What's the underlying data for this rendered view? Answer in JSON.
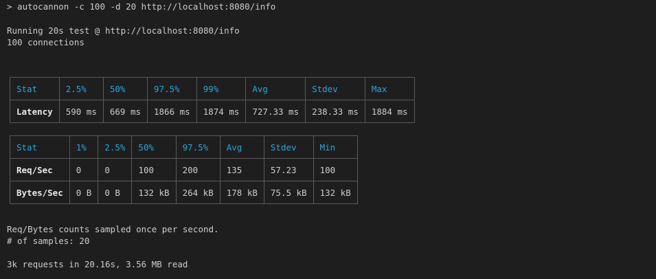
{
  "terminal": {
    "command_line": "> autocannon -c 100 -d 20 http://localhost:8080/info",
    "running_line": "Running 20s test @ http://localhost:8080/info",
    "connections_line": "100 connections",
    "footer_sampled": "Req/Bytes counts sampled once per second.",
    "footer_samples": "# of samples: 20",
    "footer_summary": "3k requests in 20.16s, 3.56 MB read"
  },
  "latency_table": {
    "headers": [
      "Stat",
      "2.5%",
      "50%",
      "97.5%",
      "99%",
      "Avg",
      "Stdev",
      "Max"
    ],
    "rows": [
      {
        "label": "Latency",
        "cells": [
          "590 ms",
          "669 ms",
          "1866 ms",
          "1874 ms",
          "727.33 ms",
          "238.33 ms",
          "1884 ms"
        ]
      }
    ]
  },
  "throughput_table": {
    "headers": [
      "Stat",
      "1%",
      "2.5%",
      "50%",
      "97.5%",
      "Avg",
      "Stdev",
      "Min"
    ],
    "rows": [
      {
        "label": "Req/Sec",
        "cells": [
          "0",
          "0",
          "100",
          "200",
          "135",
          "57.23",
          "100"
        ]
      },
      {
        "label": "Bytes/Sec",
        "cells": [
          "0 B",
          "0 B",
          "132 kB",
          "264 kB",
          "178 kB",
          "75.5 kB",
          "132 kB"
        ]
      }
    ]
  },
  "colors": {
    "background": "#1e1e1e",
    "text": "#cccccc",
    "header_accent": "#2ba4d6",
    "border": "#5a5a5a"
  }
}
